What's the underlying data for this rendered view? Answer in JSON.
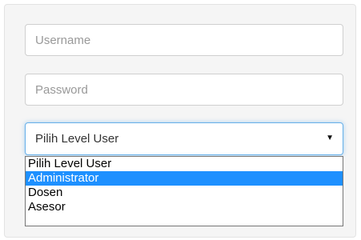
{
  "form": {
    "username_placeholder": "Username",
    "password_placeholder": "Password",
    "level_select": {
      "selected": "Pilih Level User"
    }
  },
  "dropdown": {
    "options": [
      "Pilih Level User",
      "Administrator",
      "Dosen",
      "Asesor"
    ],
    "highlighted_index": 1
  },
  "colors": {
    "panel_background": "#f5f5f5",
    "focus_border": "#66afe9",
    "highlight": "#1e90ff"
  },
  "icons": {
    "select_caret": "caret-down-icon"
  }
}
